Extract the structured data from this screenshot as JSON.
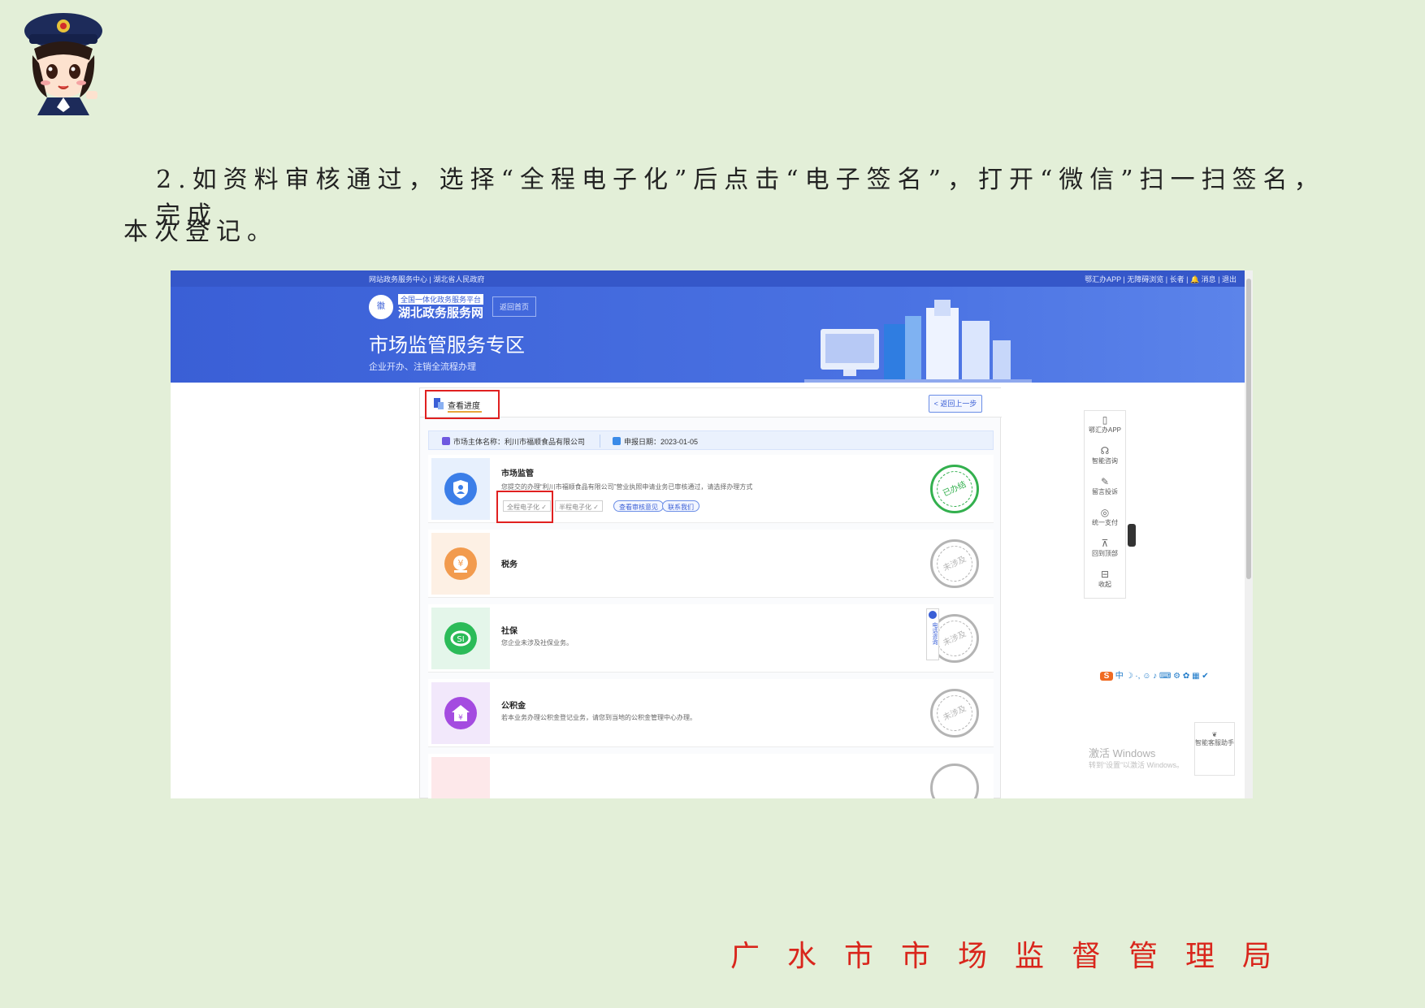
{
  "document": {
    "line1": "2.如资料审核通过，选择“全程电子化”后点击“电子签名”，打开“微信”扫一扫签名，完成",
    "line2": "本次登记。",
    "footer": "广水市市场监督管理局"
  },
  "screenshot": {
    "topbar": {
      "left": "网站政务服务中心 | 湖北省人民政府",
      "right": "鄂汇办APP | 无障碍浏览 | 长者 | 🔔 消息 | 退出"
    },
    "banner": {
      "logo_small": "全国一体化政务服务平台",
      "logo_name": "湖北政务服务网",
      "switch_label": "返回首页",
      "title": "市场监管服务专区",
      "subtitle": "企业开办、注销全流程办理"
    },
    "tab_label": "查看进度",
    "back_label": "返回上一步",
    "info": {
      "company": "市场主体名称：利川市福顺食品有限公司",
      "date": "申报日期：2023-01-05"
    },
    "items": [
      {
        "title": "市场监管",
        "desc": "您提交的办理“利川市福顺食品有限公司”营业执照申请业务已审核通过，请选择办理方式",
        "stamp": "已办结",
        "color": "#3b7ee8",
        "bg": "#e7f0fd",
        "options": [
          "全程电子化",
          "半程电子化"
        ],
        "actions": [
          "查看审核意见",
          "联系我们"
        ]
      },
      {
        "title": "税务",
        "desc": "",
        "stamp": "未涉及",
        "color": "#f29b4e",
        "bg": "#fdf0e4"
      },
      {
        "title": "社保",
        "desc": "您企业未涉及社保业务。",
        "stamp": "未涉及",
        "color": "#2bbb58",
        "bg": "#e4f6ea"
      },
      {
        "title": "公积金",
        "desc": "若本业务办理公积金登记业务，请您到当地的公积金管理中心办理。",
        "stamp": "未涉及",
        "color": "#a44be0",
        "bg": "#f2e8fb"
      }
    ],
    "sidebar": [
      {
        "glyph": "▯",
        "label": "鄂汇办APP"
      },
      {
        "glyph": "☊",
        "label": "智能咨询"
      },
      {
        "glyph": "✎",
        "label": "留言投诉"
      },
      {
        "glyph": "◎",
        "label": "统一支付"
      },
      {
        "glyph": "⊼",
        "label": "回到顶部"
      },
      {
        "glyph": "⊟",
        "label": "收起"
      }
    ],
    "phone_tab": "电话咨询",
    "ime": "中 ☽ ·, ☺ ♪ ⌨ ⚙ ✿ ▦ ✔",
    "watermark": "激活 Windows",
    "watermark_sub": "转到“设置”以激活 Windows。",
    "helper": "智能客服助手"
  }
}
